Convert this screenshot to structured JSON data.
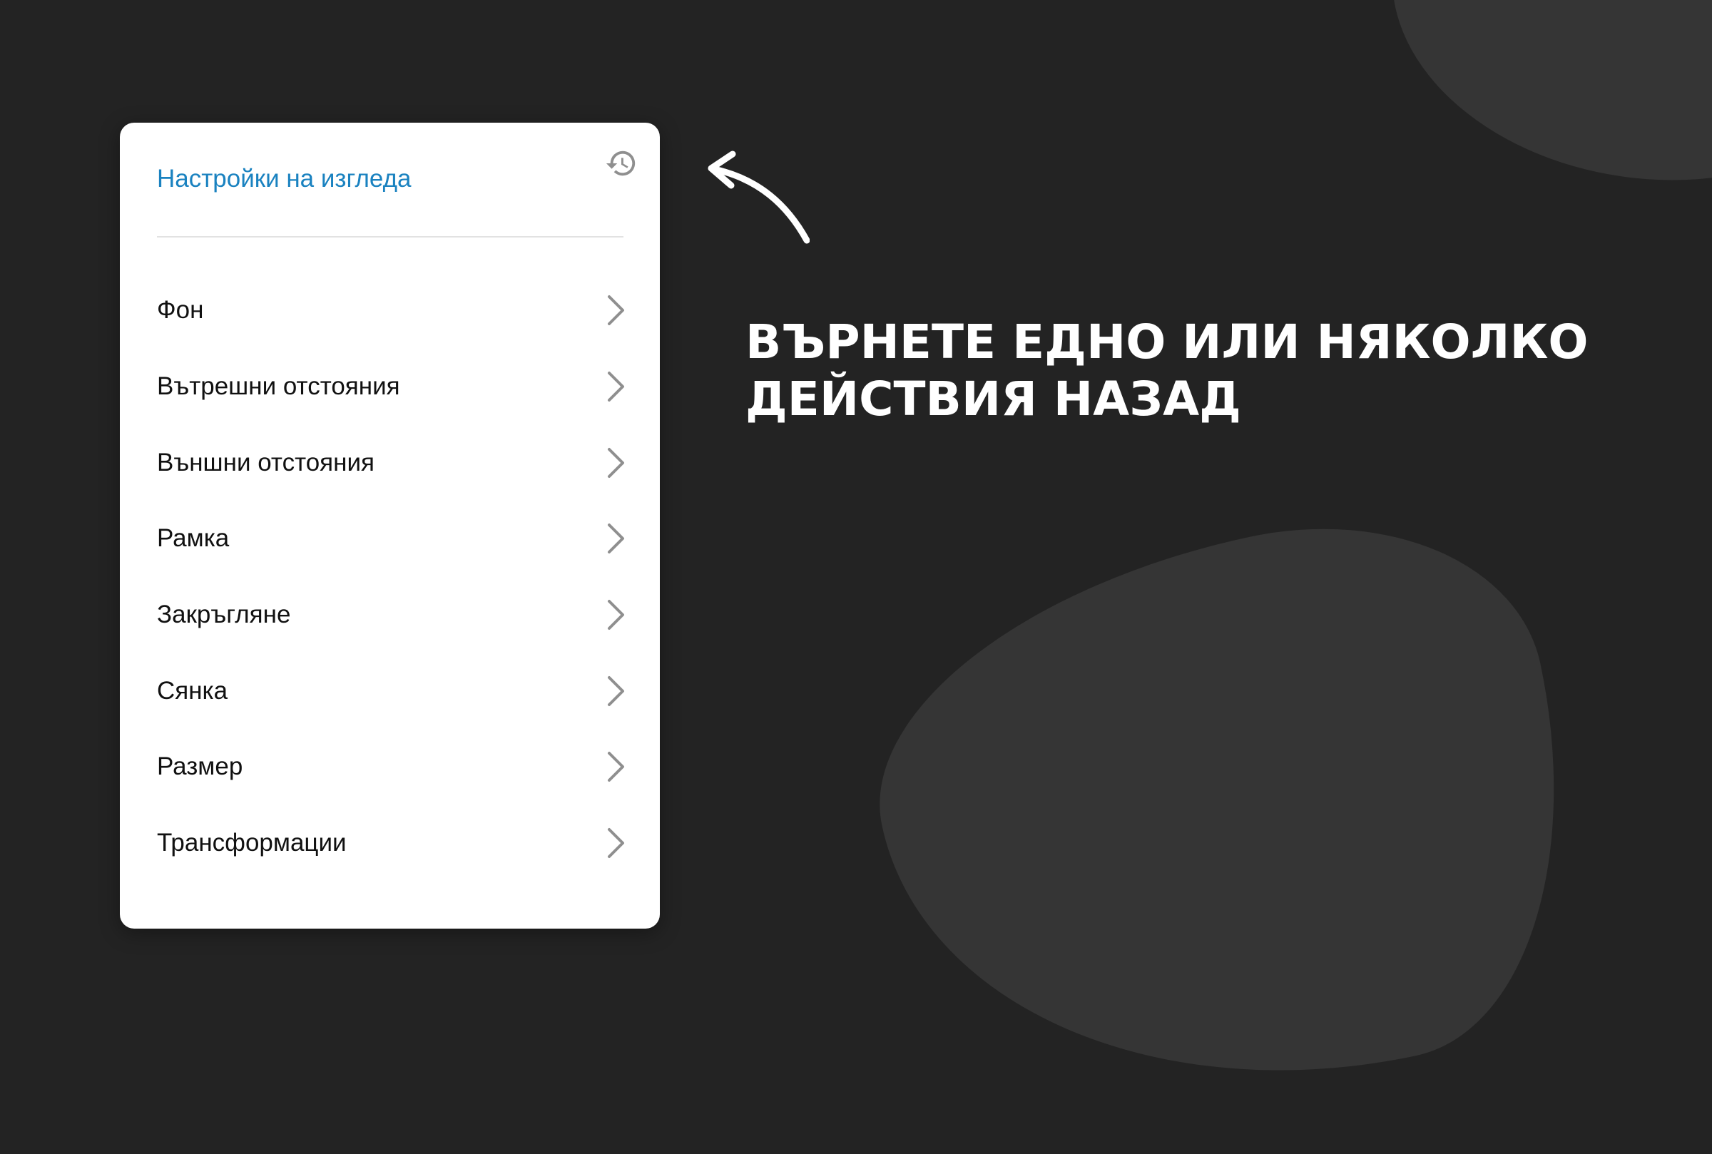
{
  "panel": {
    "title": "Настройки на изгледа",
    "history_icon": "history-icon",
    "items": [
      {
        "label": "Фон"
      },
      {
        "label": "Вътрешни отстояния"
      },
      {
        "label": "Външни отстояния"
      },
      {
        "label": "Рамка"
      },
      {
        "label": "Закръгляне"
      },
      {
        "label": "Сянка"
      },
      {
        "label": "Размер"
      },
      {
        "label": "Трансформации"
      }
    ],
    "chevron_icon": "chevron-right-icon"
  },
  "headline": {
    "line1": "ВЪРНЕТЕ ЕДНО ИЛИ НЯКОЛКО",
    "line2": "ДЕЙСТВИЯ НАЗАД"
  },
  "colors": {
    "background": "#232323",
    "blob": "#353535",
    "panel": "#ffffff",
    "title_accent": "#1a82c0",
    "icon_gray": "#8f8f8f",
    "text": "#111111",
    "headline": "#ffffff"
  }
}
